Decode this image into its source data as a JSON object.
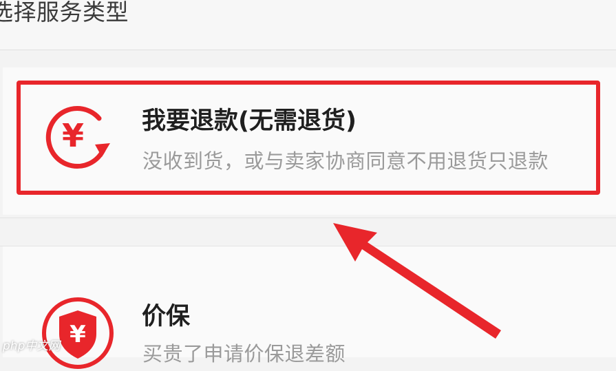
{
  "header": {
    "title": "选择服务类型"
  },
  "options": [
    {
      "title": "我要退款(无需退货)",
      "description": "没收到货，或与卖家协商同意不用退货只退款",
      "icon": "refund-yen-icon",
      "highlighted": true
    },
    {
      "title": "价保",
      "description": "买贵了申请价保退差额",
      "icon": "price-protection-shield-icon",
      "highlighted": false
    }
  ],
  "icon_glyphs": {
    "yen": "¥"
  },
  "watermark": "php中文网",
  "colors": {
    "accent": "#e8262b",
    "title_text": "#1f1f1f",
    "description_text": "#9a9a9a",
    "background": "#f3f3f3"
  }
}
